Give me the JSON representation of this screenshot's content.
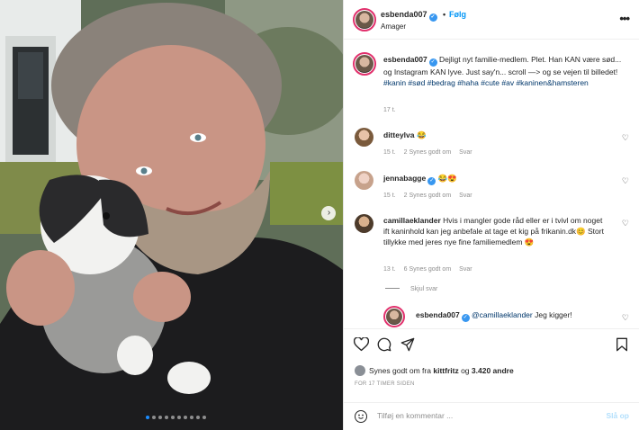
{
  "post": {
    "username": "esbenda007",
    "separator": "•",
    "follow_label": "Følg",
    "location": "Amager",
    "more_icon": "more-horizontal-icon"
  },
  "caption": {
    "username": "esbenda007",
    "text": "Dejligt nyt familie-medlem. Plet. Han KAN være sød... og Instagram KAN lyve. Just say'n... scroll —> og se vejen til billedet!",
    "tags": "#kanin #sød #bedrag #haha #cute #av #kaninen&hamsteren",
    "age": "17 t."
  },
  "comments": [
    {
      "username": "ditteylva",
      "text": "😂",
      "age": "15 t.",
      "likes": "2 Synes godt om",
      "reply": "Svar"
    },
    {
      "username": "jennabagge",
      "verified": true,
      "text": "😂😍",
      "age": "15 t.",
      "likes": "2 Synes godt om",
      "reply": "Svar"
    },
    {
      "username": "camillaeklander",
      "text": "Hvis i mangler gode råd eller er i tvivl om noget ift kaninhold kan jeg anbefale at tage et kig på frikanin.dk😊 Stort tillykke med jeres nye fine familiemedlem 😍",
      "age": "13 t.",
      "likes": "6 Synes godt om",
      "reply": "Svar"
    }
  ],
  "hide_replies": "Skjul svar",
  "reply": {
    "username": "esbenda007",
    "mention": "@camillaeklander",
    "text": "Jeg kigger!"
  },
  "actions": {
    "like_icon": "heart-icon",
    "comment_icon": "comment-icon",
    "share_icon": "send-icon",
    "save_icon": "bookmark-icon",
    "likes_prefix": "Synes godt om fra",
    "liker": "kittfritz",
    "likes_joiner": "og",
    "others": "3.420 andre",
    "time_ago": "FOR 17 TIMER SIDEN"
  },
  "compose": {
    "emoji_icon": "smiley-icon",
    "placeholder": "Tilføj en kommentar ...",
    "post_label": "Slå op"
  },
  "carousel": {
    "slides": 10,
    "active": 0
  },
  "colors": {
    "link": "#00376b",
    "follow": "#0095f6",
    "verified": "#3897f0",
    "muted": "#8e8e8e",
    "post_disabled": "#b2dffc"
  }
}
